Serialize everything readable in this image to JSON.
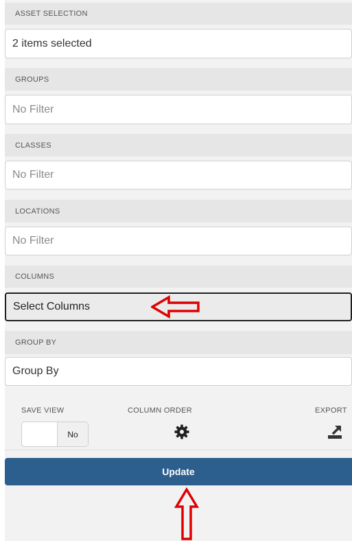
{
  "sections": {
    "asset_selection": {
      "label": "ASSET SELECTION",
      "value": "2 items selected"
    },
    "groups": {
      "label": "GROUPS",
      "value": "No Filter"
    },
    "classes": {
      "label": "CLASSES",
      "value": "No Filter"
    },
    "locations": {
      "label": "LOCATIONS",
      "value": "No Filter"
    },
    "columns": {
      "label": "COLUMNS",
      "value": "Select Columns"
    },
    "group_by": {
      "label": "GROUP BY",
      "value": "Group By"
    }
  },
  "options": {
    "save_view_label": "SAVE VIEW",
    "save_view_value": "No",
    "column_order_label": "COLUMN ORDER",
    "export_label": "EXPORT"
  },
  "update_label": "Update",
  "colors": {
    "primary_button": "#2c5f8e",
    "annotation_arrow": "#e00000"
  },
  "icons": [
    "gear-icon",
    "export-icon",
    "red-arrow-left-icon",
    "red-arrow-up-icon"
  ]
}
